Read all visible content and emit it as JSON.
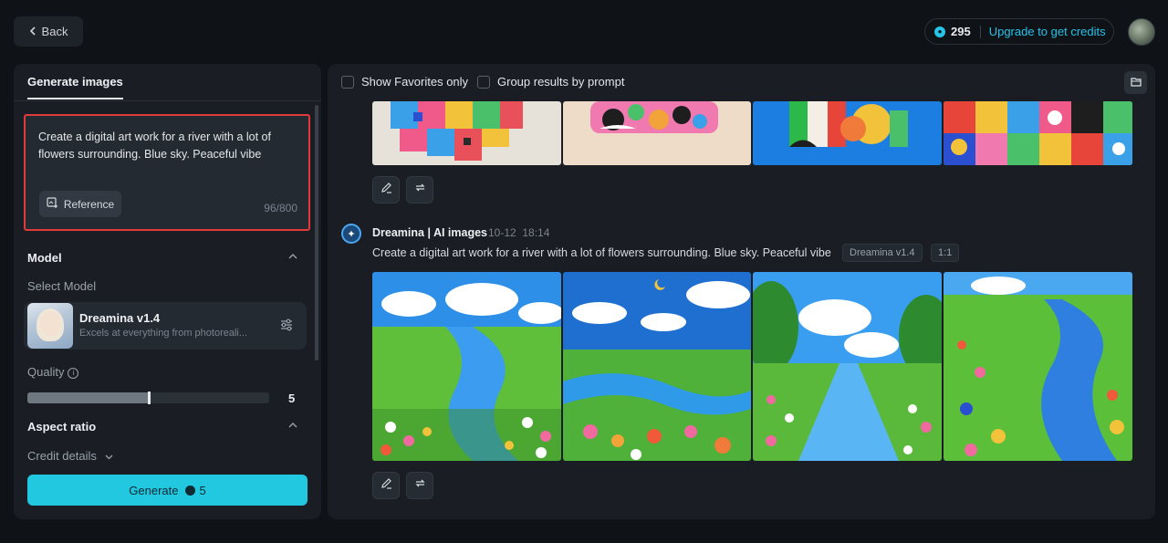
{
  "header": {
    "back_label": "Back",
    "credits": "295",
    "upgrade_label": "Upgrade to get credits"
  },
  "left_panel": {
    "tab_label": "Generate images",
    "prompt_text": "Create a digital art work for a river with a lot of flowers surrounding. Blue sky. Peaceful vibe",
    "reference_label": "Reference",
    "char_count": "96/800",
    "model_section_title": "Model",
    "select_model_label": "Select Model",
    "model_name": "Dreamina v1.4",
    "model_desc": "Excels at everything from photoreali...",
    "quality_label": "Quality",
    "quality_value": "5",
    "quality_fraction": 0.5,
    "aspect_ratio_title": "Aspect ratio",
    "credit_details_label": "Credit details",
    "generate_label": "Generate",
    "generate_cost": "5"
  },
  "right_panel": {
    "show_favorites_label": "Show Favorites only",
    "group_results_label": "Group results by prompt",
    "generation": {
      "author": "Dreamina | AI images",
      "date": "10-12",
      "time": "18:14",
      "prompt": "Create a digital art work for a river with a lot of flowers surrounding. Blue sky. Peaceful vibe",
      "model_tag": "Dreamina v1.4",
      "ratio_tag": "1:1"
    }
  },
  "colors": {
    "accent": "#22c7e0",
    "highlight_border": "#e03a3a",
    "background": "#0f1216",
    "panel": "#1a1e24"
  }
}
